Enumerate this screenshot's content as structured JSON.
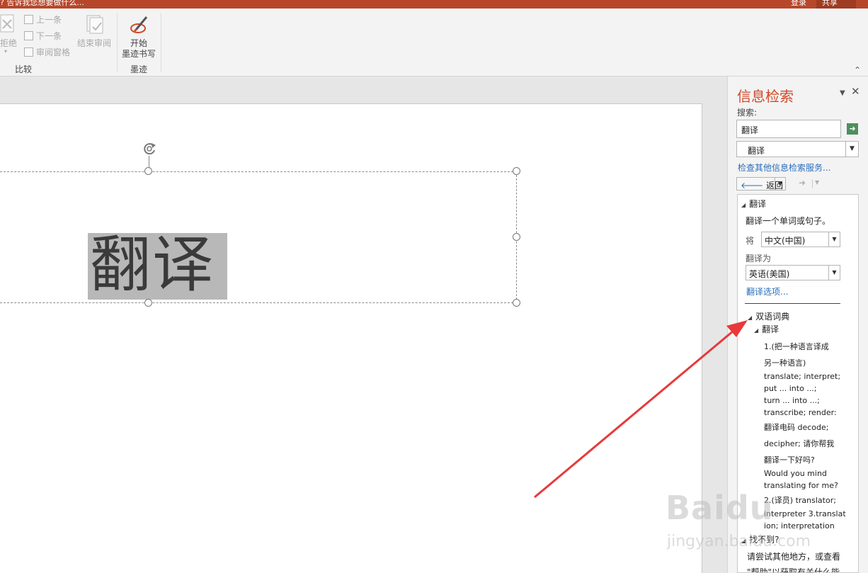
{
  "titlebar": {
    "tell_me": "? 告诉我您想要做什么...",
    "login": "登录",
    "share": "共享"
  },
  "ribbon": {
    "compare_group": {
      "reject": "拒绝",
      "previous": "上一条",
      "next": "下一条",
      "reviewing_pane": "审阅窗格",
      "end_review": "结束审阅",
      "label": "比较"
    },
    "ink_group": {
      "start_inking_line1": "开始",
      "start_inking_line2": "墨迹书写",
      "label": "墨迹"
    }
  },
  "slide": {
    "text": "翻译"
  },
  "research_pane": {
    "title": "信息检索",
    "search_label": "搜索:",
    "search_value": "翻译",
    "service": "翻译",
    "more_services": "检查其他信息检索服务...",
    "back": "返回",
    "results": {
      "section_title": "翻译",
      "description": "翻译一个单词或句子。",
      "from_label": "将",
      "from_lang": "中文(中国)",
      "to_label": "翻译为",
      "to_lang": "英语(美国)",
      "options_link": "翻译选项...",
      "dict_title": "双语词典",
      "entry_title": "翻译",
      "entry_lines": [
        "1.(把一种语言译成",
        "另一种语言)",
        "translate; interpret;",
        "put ... into ...;",
        "turn ... into ...;",
        "transcribe; render:",
        "翻译电码 decode;",
        "decipher; 请你帮我",
        "翻译一下好吗?",
        "Would you mind",
        "translating for me?",
        "2.(译员) translator;",
        "interpreter 3.translat",
        "ion; interpretation"
      ],
      "not_found_title": "找不到?",
      "not_found_line1": "请尝试其他地方，或查看",
      "not_found_line2": "\"帮助\"以获取有关什么能"
    }
  },
  "watermark": {
    "brand": "Baidu",
    "site": "jingyan.baidu.com"
  },
  "colors": {
    "titlebar": "#b7472a",
    "pane_title": "#d04a2a",
    "link": "#2a6ebb",
    "arrow": "#e8393a"
  }
}
